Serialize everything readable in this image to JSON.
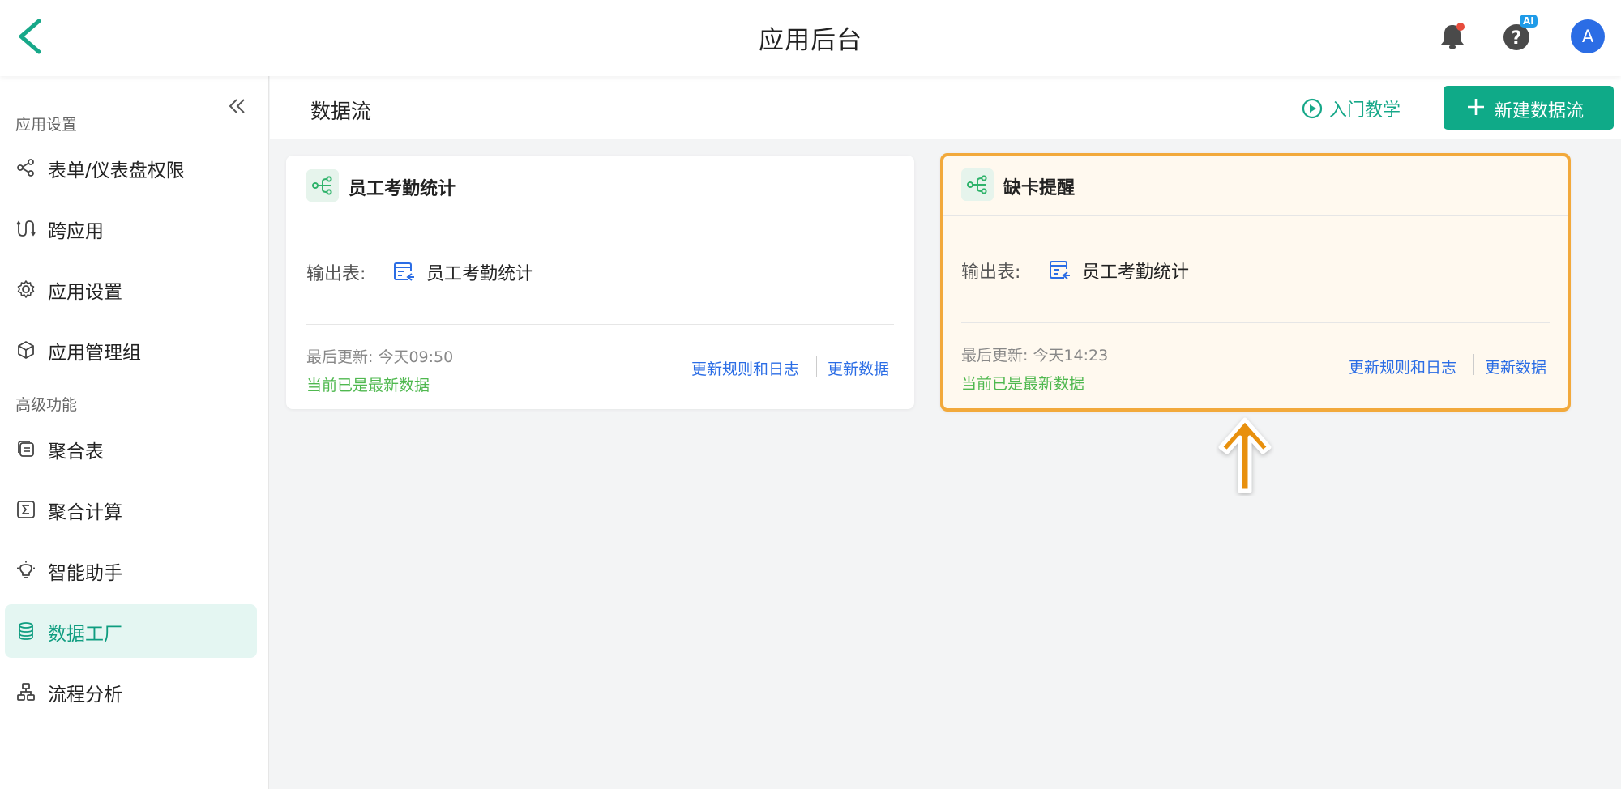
{
  "topbar": {
    "title": "应用后台",
    "ai_badge": "AI",
    "avatar_letter": "A"
  },
  "sidebar": {
    "sections": [
      {
        "title": "应用设置",
        "items": [
          {
            "label": "表单/仪表盘权限",
            "icon": "share-nodes-icon"
          },
          {
            "label": "跨应用",
            "icon": "cross-app-icon"
          },
          {
            "label": "应用设置",
            "icon": "gear-icon"
          },
          {
            "label": "应用管理组",
            "icon": "cube-icon"
          }
        ]
      },
      {
        "title": "高级功能",
        "items": [
          {
            "label": "聚合表",
            "icon": "aggregate-table-icon"
          },
          {
            "label": "聚合计算",
            "icon": "sigma-icon"
          },
          {
            "label": "智能助手",
            "icon": "lightbulb-icon"
          },
          {
            "label": "数据工厂",
            "icon": "database-icon",
            "active": true
          },
          {
            "label": "流程分析",
            "icon": "org-chart-icon"
          }
        ]
      }
    ]
  },
  "main": {
    "title": "数据流",
    "tutorial_label": "入门教学",
    "new_button_label": "新建数据流"
  },
  "cards": [
    {
      "title": "员工考勤统计",
      "output_label": "输出表:",
      "output_table": "员工考勤统计",
      "last_updated": "最后更新:  今天09:50",
      "status": "当前已是最新数据",
      "rules_link": "更新规则和日志",
      "update_link": "更新数据"
    },
    {
      "title": "缺卡提醒",
      "output_label": "输出表:",
      "output_table": "员工考勤统计",
      "last_updated": "最后更新:  今天14:23",
      "status": "当前已是最新数据",
      "rules_link": "更新规则和日志",
      "update_link": "更新数据",
      "highlighted": true
    }
  ],
  "colors": {
    "brand": "#0faa88",
    "link": "#2b6de5",
    "status_ok": "#4fb84f",
    "highlight_border": "#f2a93b",
    "highlight_arrow": "#e8900c"
  }
}
